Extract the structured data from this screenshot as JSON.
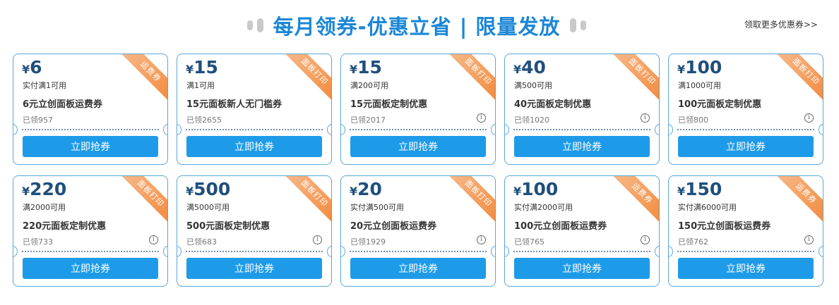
{
  "header": {
    "title": "每月领券-优惠立省 | 限量发放",
    "more_link": "领取更多优惠券>>"
  },
  "colors": {
    "title": "#1b86d6",
    "button": "#1e9be8",
    "border": "#5aa7d9",
    "ribbon": "#f28a3c",
    "price": "#1f4f7d"
  },
  "coupons": [
    {
      "currency": "¥",
      "amount": "6",
      "condition": "实付满1可用",
      "name": "6元立创面板运费券",
      "claimed": "已领957",
      "tag": "运费券",
      "button": "立即抢券",
      "info_icon": false
    },
    {
      "currency": "¥",
      "amount": "15",
      "condition": "满1可用",
      "name": "15元面板新人无门槛券",
      "claimed": "已领2655",
      "tag": "面板打印",
      "button": "立即抢券",
      "info_icon": false
    },
    {
      "currency": "¥",
      "amount": "15",
      "condition": "满200可用",
      "name": "15元面板定制优惠",
      "claimed": "已领2017",
      "tag": "面板打印",
      "button": "立即抢券",
      "info_icon": true
    },
    {
      "currency": "¥",
      "amount": "40",
      "condition": "满500可用",
      "name": "40元面板定制优惠",
      "claimed": "已领1020",
      "tag": "面板打印",
      "button": "立即抢券",
      "info_icon": true
    },
    {
      "currency": "¥",
      "amount": "100",
      "condition": "满1000可用",
      "name": "100元面板定制优惠",
      "claimed": "已领800",
      "tag": "面板打印",
      "button": "立即抢券",
      "info_icon": true
    },
    {
      "currency": "¥",
      "amount": "220",
      "condition": "满2000可用",
      "name": "220元面板定制优惠",
      "claimed": "已领733",
      "tag": "面板打印",
      "button": "立即抢券",
      "info_icon": true
    },
    {
      "currency": "¥",
      "amount": "500",
      "condition": "满5000可用",
      "name": "500元面板定制优惠",
      "claimed": "已领683",
      "tag": "面板打印",
      "button": "立即抢券",
      "info_icon": true
    },
    {
      "currency": "¥",
      "amount": "20",
      "condition": "实付满500可用",
      "name": "20元立创面板运费券",
      "claimed": "已领1929",
      "tag": "面板打印",
      "button": "立即抢券",
      "info_icon": true
    },
    {
      "currency": "¥",
      "amount": "100",
      "condition": "实付满2000可用",
      "name": "100元立创面板运费券",
      "claimed": "已领765",
      "tag": "运费券",
      "button": "立即抢券",
      "info_icon": true
    },
    {
      "currency": "¥",
      "amount": "150",
      "condition": "实付满6000可用",
      "name": "150元立创面板运费券",
      "claimed": "已领762",
      "tag": "运费券",
      "button": "立即抢券",
      "info_icon": true
    }
  ]
}
